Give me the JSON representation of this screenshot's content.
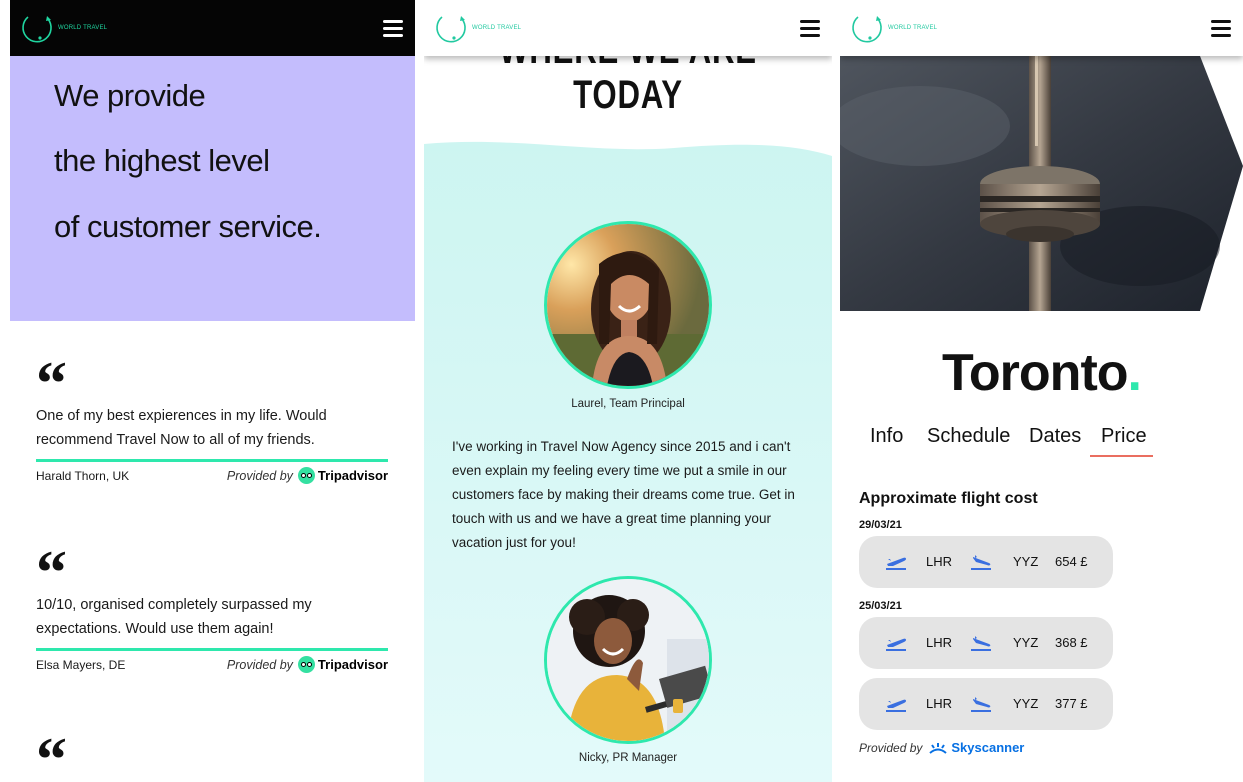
{
  "brand": {
    "logo_text": "WORLD TRAVEL",
    "accent_color": "#2ee8ad",
    "hero_color": "#c4bdfd",
    "dark_nav_color": "#050505"
  },
  "panel1": {
    "hero_lines": [
      "We provide",
      "the highest level",
      "of customer service."
    ],
    "provided_by_label": "Provided by",
    "tripadvisor_label": "Tripadvisor",
    "reviews": [
      {
        "quote": "“",
        "text": "One of my best expierences in my life. Would recommend Travel Now to all of my friends.",
        "author": "Harald Thorn, UK"
      },
      {
        "quote": "“",
        "text": "10/10, organised completely surpassed my expectations. Would use them again!",
        "author": "Elsa Mayers, DE"
      },
      {
        "quote": "“"
      }
    ]
  },
  "panel2": {
    "heading": "WHERE WE ARE TODAY",
    "band_color": "#d3f7f3",
    "people": [
      {
        "caption": "Laurel, Team Principal"
      },
      {
        "caption": "Nicky, PR Manager"
      }
    ],
    "bio": "I've working in Travel Now Agency since 2015 and i can't even explain my feeling every time we put a smile in our customers face by making their dreams come true. Get in touch with us and we have a great time planning your vacation just for you!"
  },
  "panel3": {
    "city": "Toronto",
    "city_dot": ".",
    "tabs": [
      {
        "label": "Info",
        "active": false
      },
      {
        "label": "Schedule",
        "active": false
      },
      {
        "label": "Dates",
        "active": false
      },
      {
        "label": "Price",
        "active": true
      }
    ],
    "tab_underline_color": "#ea6e60",
    "flight_heading": "Approximate flight cost",
    "flights": [
      {
        "date": "29/03/21",
        "from": "LHR",
        "to": "YYZ",
        "price": "654 £"
      },
      {
        "date": "25/03/21",
        "from": "LHR",
        "to": "YYZ",
        "price": "368 £"
      },
      {
        "date": "",
        "from": "LHR",
        "to": "YYZ",
        "price": "377 £"
      }
    ],
    "provided_by_label": "Provided by",
    "skyscanner_label": "Skyscanner",
    "icon_color": "#3a6fe0"
  }
}
